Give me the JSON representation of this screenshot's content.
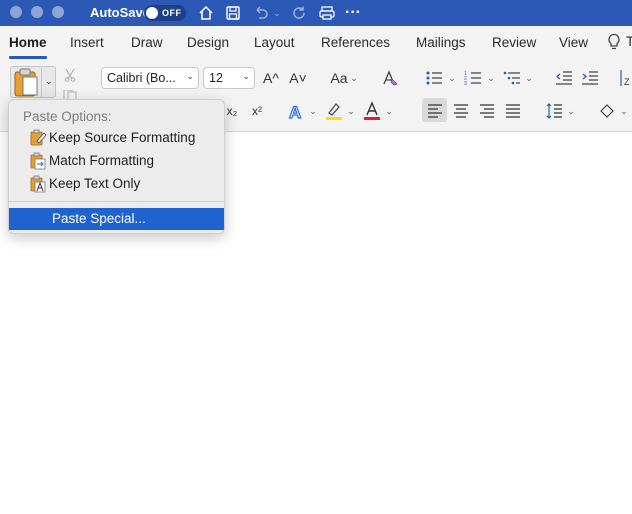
{
  "titlebar": {
    "autosave_label": "AutoSave",
    "autosave_state": "OFF"
  },
  "tabs": [
    {
      "label": "Home",
      "active": true
    },
    {
      "label": "Insert"
    },
    {
      "label": "Draw"
    },
    {
      "label": "Design"
    },
    {
      "label": "Layout"
    },
    {
      "label": "References"
    },
    {
      "label": "Mailings"
    },
    {
      "label": "Review"
    },
    {
      "label": "View"
    }
  ],
  "ribbon": {
    "font_name": "Calibri (Bo...",
    "font_size": "12",
    "grow_font": "A^",
    "shrink_font": "A˅",
    "change_case": "Aa",
    "subscript": "x₂",
    "superscript": "x²"
  },
  "paste_menu": {
    "title": "Paste Options:",
    "items": [
      {
        "label": "Keep Source Formatting"
      },
      {
        "label": "Match Formatting"
      },
      {
        "label": "Keep Text Only"
      }
    ],
    "special": "Paste Special..."
  },
  "colors": {
    "titlebar": "#2b59b5",
    "menu_highlight": "#1f63d0",
    "highlight_yellow": "#f2e01b",
    "font_red": "#e02020"
  }
}
